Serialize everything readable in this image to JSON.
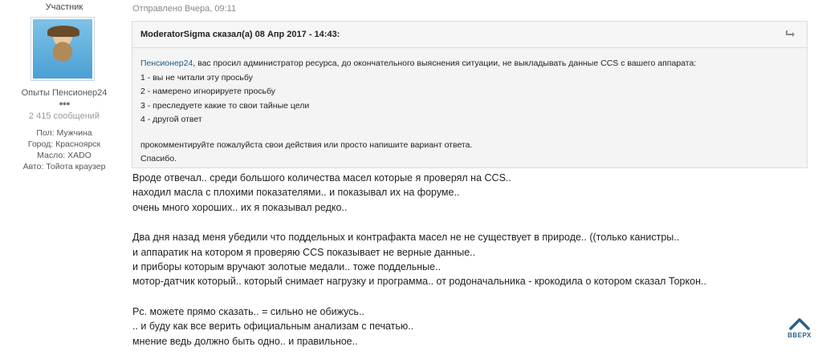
{
  "author": {
    "role": "Участник",
    "group": "Опыты Пенсионер24",
    "pips": "●●●",
    "post_count": "2 415 сообщений",
    "fields": [
      {
        "label": "Пол:",
        "value": "Мужчина"
      },
      {
        "label": "Город:",
        "value": "Красноярск"
      },
      {
        "label": "Масло:",
        "value": "XADO"
      },
      {
        "label": "Авто:",
        "value": "Тойота краузер"
      }
    ]
  },
  "post": {
    "posted": "Отправлено Вчера, 09:11",
    "quote": {
      "citation": "ModeratorSigma сказал(а) 08 Апр 2017 - 14:43:",
      "mention": "Пенсионер24",
      "first_line_rest": ", вас просил администратор ресурса, до окончательного выяснения ситуации, не выкладывать данные CCS с вашего аппарата:",
      "options": [
        "1 - вы не читали  эту просьбу",
        "2 - намерено игнорируете просьбу",
        "3 - преследуете какие то свои тайные цели",
        "4 - другой ответ"
      ],
      "request": "прокомментируйте пожалуйста свои действия или просто напишите вариант ответа.",
      "thanks": "Спасибо."
    },
    "lines_1": [
      "Вроде отвечал.. среди большого количества масел которые я проверял на CCS..",
      "находил масла с плохими показателями.. и показывал их на форуме..",
      "очень много хороших.. их я показывал редко.."
    ],
    "lines_2": [
      "Два дня назад меня убедили что поддельных и контрафакта масел не не существует в природе.. ((только канистры..",
      "и аппаратик на котором я проверяю CCS показывает не верные данные..",
      "и приборы которым вручают золотые медали.. тоже поддельные..",
      "мотор-датчик который.. который снимает нагрузку и программа.. от родоначальника - крокодила о котором сказал Торкон.."
    ],
    "lines_3": [
      "Рс. можете прямо сказать.. =  сильно не обижусь..",
      ".. и буду как все верить официальным анализам с печатью..",
      "мнение ведь должно быть одно.. и правильное.."
    ]
  },
  "scroll_top": {
    "label": "ВВЕРХ",
    "icon": "chevron-up-icon",
    "color": "#2a5e8b"
  }
}
